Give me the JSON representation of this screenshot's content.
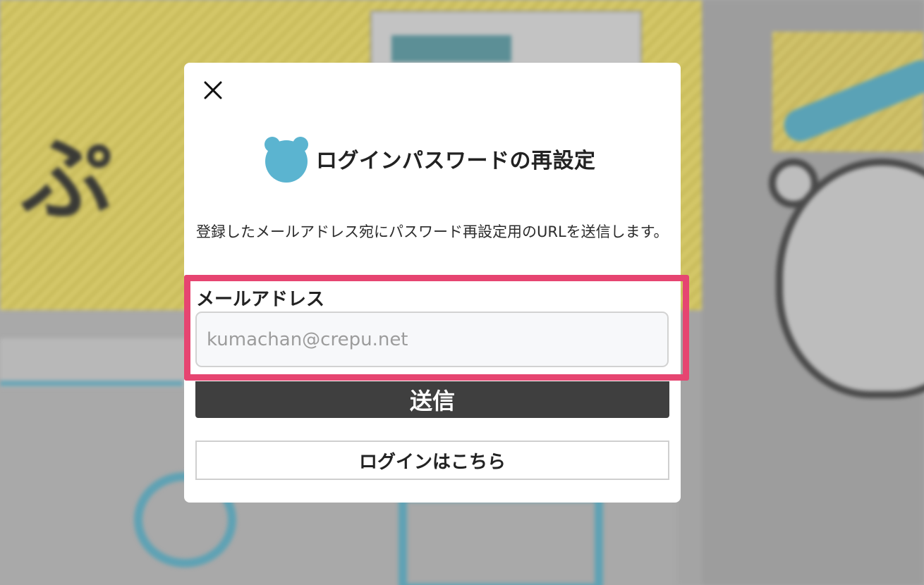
{
  "modal": {
    "title": "ログインパスワードの再設定",
    "description": "登録したメールアドレス宛にパスワード再設定用のURLを送信します。",
    "close_icon": "close-icon",
    "logo_icon": "bear-icon"
  },
  "form": {
    "email_label": "メールアドレス",
    "email_placeholder": "kumachan@crepu.net",
    "email_value": "",
    "submit_label": "送信",
    "login_link_label": "ログインはこちら"
  },
  "colors": {
    "accent_blue": "#5bb4d0",
    "highlight_pink": "#e64571",
    "submit_bg": "#3f3f3f"
  }
}
